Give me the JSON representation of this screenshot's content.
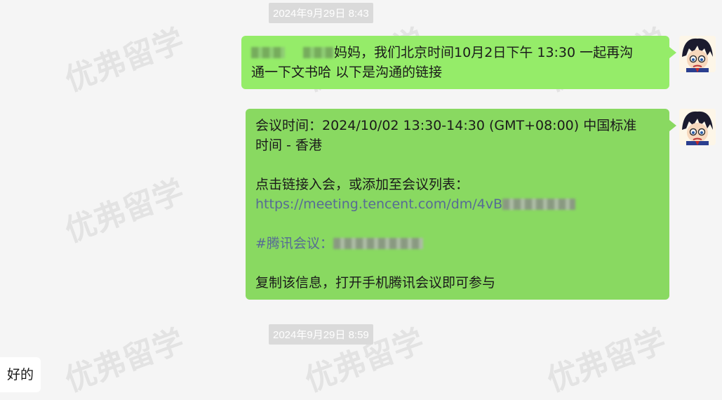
{
  "watermark_text": "优弗留学",
  "timestamps": [
    "2024年9月29日 8:43",
    "2024年9月29日 8:59"
  ],
  "messages": {
    "m1": {
      "line1": "妈妈，我们北京时间10月2日下午 13:30 一起再沟",
      "line2": "通一下文书哈  以下是沟通的链接"
    },
    "m2": {
      "time_line1": "会议时间：2024/10/02 13:30-14:30 (GMT+08:00) 中国标准",
      "time_line2": "时间 - 香港",
      "join_text": "点击链接入会，或添加至会议列表：",
      "link": "https://meeting.tencent.com/dm/4vB",
      "meeting_label": "#腾讯会议：",
      "footer": "复制该信息，打开手机腾讯会议即可参与"
    },
    "m3": {
      "text": "好的"
    }
  },
  "colors": {
    "outgoing_bubble": "#95ec69",
    "outgoing_bubble_selected": "#89d961",
    "link": "#576b95",
    "background": "#f5f5f5"
  }
}
